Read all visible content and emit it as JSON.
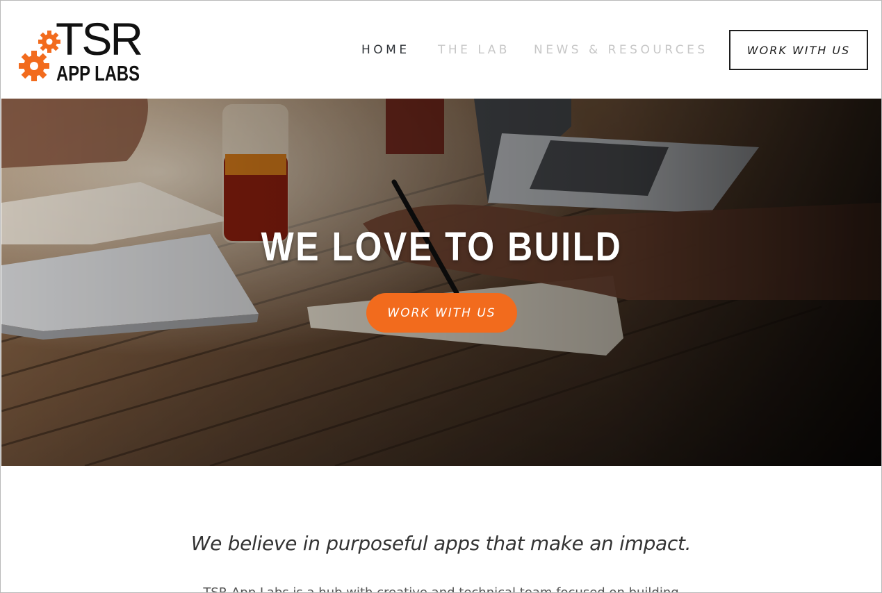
{
  "logo": {
    "wordmark_top": "TSR",
    "wordmark_bottom": "APP LABS",
    "gear_color": "#f26b1d"
  },
  "nav": {
    "items": [
      {
        "label": "HOME",
        "active": true
      },
      {
        "label": "THE LAB",
        "active": false
      },
      {
        "label": "NEWS & RESOURCES",
        "active": false
      }
    ],
    "cta_label": "WORK WITH US"
  },
  "hero": {
    "title": "WE LOVE TO BUILD",
    "cta_label": "WORK WITH US",
    "cta_color": "#f26b1d"
  },
  "intro": {
    "tagline": "We believe in purposeful apps that make an impact.",
    "body": "TSR App Labs is a hub with creative and technical team focused on building"
  },
  "colors": {
    "accent": "#f26b1d",
    "nav_active": "#2f3338",
    "nav_inactive": "#c7c7c7"
  }
}
